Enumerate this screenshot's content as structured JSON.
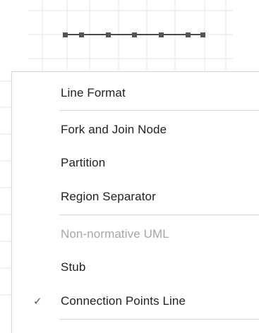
{
  "menu": {
    "items": [
      {
        "label": "Line Format",
        "checked": false,
        "enabled": true
      },
      {
        "label": "Fork and Join Node",
        "checked": false,
        "enabled": true
      },
      {
        "label": "Partition",
        "checked": false,
        "enabled": true
      },
      {
        "label": "Region Separator",
        "checked": false,
        "enabled": true
      },
      {
        "label": "Non-normative UML",
        "checked": false,
        "enabled": false
      },
      {
        "label": "Stub",
        "checked": false,
        "enabled": true
      },
      {
        "label": "Connection Points Line",
        "checked": true,
        "enabled": true
      }
    ],
    "check_glyph": "✓"
  },
  "colors": {
    "text": "#222222",
    "disabled_text": "#a6a6a6",
    "separator": "#d6d6d6",
    "grid": "#e6e6e6",
    "shape": "#555555"
  }
}
